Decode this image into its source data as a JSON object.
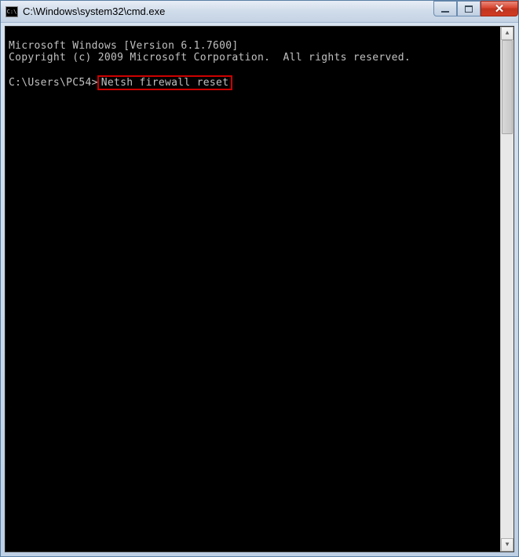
{
  "titlebar": {
    "icon_label": "C:\\",
    "title": "C:\\Windows\\system32\\cmd.exe"
  },
  "terminal": {
    "line1": "Microsoft Windows [Version 6.1.7600]",
    "line2": "Copyright (c) 2009 Microsoft Corporation.  All rights reserved.",
    "prompt": "C:\\Users\\PC54>",
    "command": "Netsh firewall reset"
  },
  "controls": {
    "minimize": "minimize",
    "maximize": "maximize",
    "close": "close"
  },
  "scrollbar": {
    "up": "▲",
    "down": "▼"
  }
}
